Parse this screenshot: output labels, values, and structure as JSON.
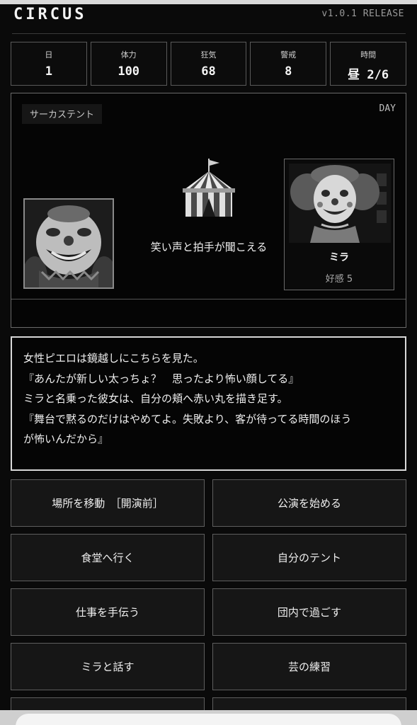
{
  "header": {
    "logo": "CIRCUS",
    "version": "v1.0.1 RELEASE"
  },
  "stats": [
    {
      "label": "日",
      "value": "1"
    },
    {
      "label": "体力",
      "value": "100"
    },
    {
      "label": "狂気",
      "value": "68"
    },
    {
      "label": "警戒",
      "value": "8"
    },
    {
      "label": "時間",
      "value": "昼 2/6"
    }
  ],
  "scene": {
    "location": "サーカステント",
    "time_of_day": "DAY",
    "description": "笑い声と拍手が聞こえる",
    "npc": {
      "name": "ミラ",
      "affinity": "好感 5"
    }
  },
  "dialog": {
    "lines": [
      "女性ピエロは鏡越しにこちらを見た。",
      "『あんたが新しい太っちょ？　思ったより怖い顔してる』",
      "ミラと名乗った彼女は、自分の頬へ赤い丸を描き足す。",
      "『舞台で黙るのだけはやめてよ。失敗より、客が待ってる時間のほう",
      "が怖いんだから』"
    ]
  },
  "actions": [
    "場所を移動　［開演前］",
    "公演を始める",
    "食堂へ行く",
    "自分のテント",
    "仕事を手伝う",
    "団内で過ごす",
    "ミラと話す",
    "芸の練習"
  ],
  "colors": {
    "background": "#0a0a0a",
    "border": "#5e5e5e",
    "text": "#efefef",
    "dialog_border": "#d8d8d8"
  }
}
